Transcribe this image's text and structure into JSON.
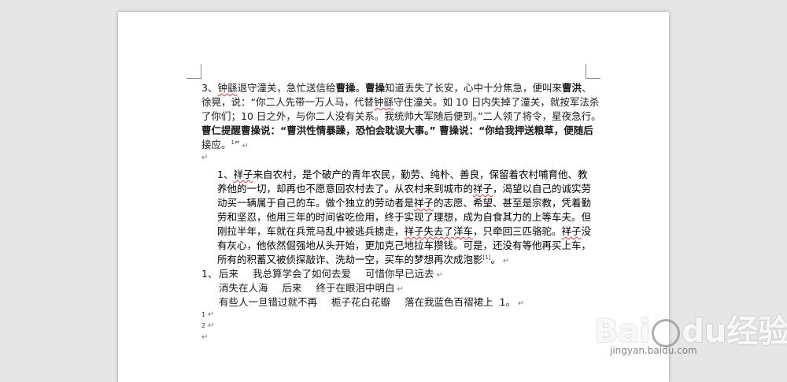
{
  "paragraph1": {
    "line1": {
      "p1": "3、",
      "p2": "钟繇",
      "p3": "退守潼关，急忙送信给",
      "p4": "曹操",
      "p5": "。",
      "p6": "曹操",
      "p7": "知道丢失了长安，心中十分焦急，便叫来",
      "p8": "曹洪",
      "p9": "、"
    },
    "line2": {
      "p1": "徐晃，说：“你二人先带一万人马，代替",
      "p2": "钟繇",
      "p3": "守住潼关。如 10 日内失掉了潼关，就按军法杀"
    },
    "line3": "了你们；10 日之外，与你二人没有关系。我统帅大军随后便到。”二人领了将令，星夜急行。",
    "line4": {
      "p1": "曹仁提醒",
      "p2": "曹操",
      "p3": "说：“曹洪性情暴躁，恐怕会耽误大事。” 曹操说：“你给我押送粮草，便随后"
    },
    "line5": "接应。",
    "line5_sup": "1",
    "line5_end": "”"
  },
  "paragraph2": {
    "line1": {
      "p1": "1、",
      "p2": "祥子",
      "p3": "来自农村，是个破产的青年农民，勤劳、纯朴、善良，保留着农村哺育他、教"
    },
    "line2": {
      "p1": "养他的一切，却再也不愿意回农村去了。从农村来到城市的",
      "p2": "祥子",
      "p3": "，渴望以自己的诚实劳"
    },
    "line3": {
      "p1": "动买一辆属于自己的车。做个独立的劳动者是",
      "p2": "祥子",
      "p3": "的志愿、希望、甚至是宗教，凭着勤"
    },
    "line4": "劳和坚忍，他用三年的时间省吃俭用，终于实现了理想，成为自食其力的上等车夫。但",
    "line5": {
      "p1": "刚拉半年，车就在兵荒马乱中被逃兵掳走，",
      "p2": "祥子失去了洋车",
      "p3": "，只牵回三匹骆驼。",
      "p4": "祥子",
      "p5": "没"
    },
    "line6": "有灰心，他依然倔强地从头开始，更加克己地拉车攒钱。可是，还没有等他再买上车，",
    "line7": "所有的积蓄又被侦探敲诈、洗劫一空，买车的梦想再次成泡影",
    "line7_sup": "[1]",
    "line7_end": "。"
  },
  "list": {
    "line1": {
      "num": "1、",
      "a": "后来",
      "b": "我总算学会了如何去爱",
      "c": "可惜你早已远去"
    },
    "line2": {
      "a": "消失在人海",
      "b": "后来",
      "c": "终于在眼泪中明白"
    },
    "line3": {
      "a": "有些人一旦错过就不再",
      "b": "栀子花白花瓣",
      "c": "落在我蓝色百褶裙上",
      "d": "1。"
    }
  },
  "footnotes": {
    "f1": "1",
    "f2": "2"
  },
  "marks": {
    "para": "↵"
  },
  "watermark": {
    "logo_a": "Bai",
    "logo_b": "du",
    "logo_c": "经验",
    "url": "jingyan.baidu.com"
  },
  "colors": {
    "background": "#e6e6e6",
    "page": "#ffffff",
    "spellcheck": "#e03a3a"
  }
}
